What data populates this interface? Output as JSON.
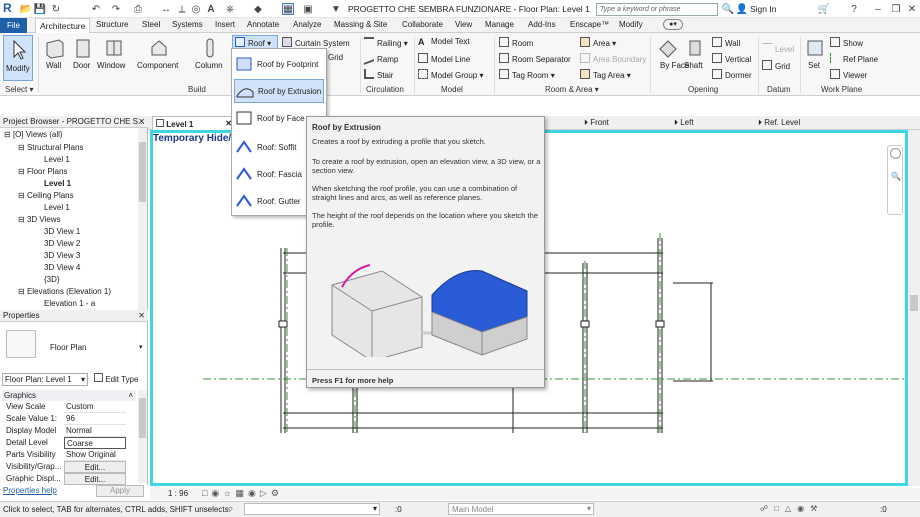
{
  "titlebar": {
    "app_letter": "R",
    "title": "PROGETTO CHE SEMBRA FUNZIONARE - Floor Plan: Level 1",
    "search_placeholder": "Type a keyword or phrase",
    "sign_in": "Sign In"
  },
  "tabs": [
    "File",
    "Architecture",
    "Structure",
    "Steel",
    "Systems",
    "Insert",
    "Annotate",
    "Analyze",
    "Massing & Site",
    "Collaborate",
    "View",
    "Manage",
    "Add-Ins",
    "Enscape™",
    "Modify"
  ],
  "ribbon": {
    "modify": "Modify",
    "select": "Select",
    "build": {
      "wall": "Wall",
      "door": "Door",
      "window": "Window",
      "component": "Component",
      "column": "Column",
      "roof": "Roof",
      "curtain_system": "Curtain System",
      "grid": "Grid",
      "title": "Build"
    },
    "circulation": {
      "railing": "Railing",
      "ramp": "Ramp",
      "stair": "Stair",
      "title": "Circulation"
    },
    "model": {
      "text": "Model Text",
      "line": "Model Line",
      "group": "Model Group",
      "title": "Model"
    },
    "room_area": {
      "room": "Room",
      "separator": "Room Separator",
      "tag_room": "Tag Room",
      "area": "Area",
      "boundary": "Area Boundary",
      "tag_area": "Tag Area",
      "title": "Room & Area"
    },
    "opening": {
      "by_face": "By Face",
      "shaft": "Shaft",
      "wall": "Wall",
      "vertical": "Vertical",
      "dormer": "Dormer",
      "title": "Opening"
    },
    "datum": {
      "level": "Level",
      "grid": "Grid",
      "title": "Datum"
    },
    "work_plane": {
      "set": "Set",
      "show": "Show",
      "ref_plane": "Ref Plane",
      "viewer": "Viewer",
      "title": "Work Plane"
    }
  },
  "dropdown": [
    "Roof by Footprint",
    "Roof by Extrusion",
    "Roof by Face",
    "Roof: Soffit",
    "Roof: Fascia",
    "Roof: Gutter"
  ],
  "tooltip": {
    "title": "Roof by Extrusion",
    "p1": "Creates a roof by extruding a profile that you sketch.",
    "p2": "To create a roof by extrusion, open an elevation view, a 3D view, or a section view.",
    "p3": "When sketching the roof profile, you can use a combination of straight lines and arcs, as well as reference planes.",
    "p4": "The height of the roof depends on the location where you sketch the profile.",
    "help": "Press F1 for more help"
  },
  "project_browser": {
    "title": "Project Browser - PROGETTO CHE S...",
    "items": [
      "Views (all)",
      "Structural Plans",
      "Level 1",
      "Floor Plans",
      "Level 1",
      "Ceiling Plans",
      "Level 1",
      "3D Views",
      "3D View 1",
      "3D View 2",
      "3D View 3",
      "3D View 4",
      "{3D}",
      "Elevations (Elevation 1)",
      "Elevation 1 - a"
    ]
  },
  "properties": {
    "title": "Properties",
    "type": "Floor Plan",
    "instance": "Floor Plan: Level 1",
    "edit_type": "Edit Type",
    "section": "Graphics",
    "rows": [
      [
        "View Scale",
        "Custom"
      ],
      [
        "Scale Value  1:",
        "96"
      ],
      [
        "Display Model",
        "Normal"
      ],
      [
        "Detail Level",
        "Coarse"
      ],
      [
        "Parts Visibility",
        "Show Original"
      ],
      [
        "Visibility/Grap...",
        "Edit..."
      ],
      [
        "Graphic Displ...",
        "Edit..."
      ]
    ],
    "help": "Properties help",
    "apply": "Apply"
  },
  "view_tabs": [
    "Level 1",
    "Front",
    "Left",
    "Ref. Level"
  ],
  "canvas": {
    "temp_label": "Temporary Hide/"
  },
  "viewbar": {
    "scale": "1 : 96"
  },
  "statusbar": {
    "message": "Click to select, TAB for alternates, CTRL adds, SHIFT unselects.",
    "zero": ":0",
    "model": "Main Model"
  },
  "colors": {
    "accent": "#1f5fa8",
    "canvas_border": "#3cd6e6",
    "roof_blue": "#2a5bd6"
  }
}
